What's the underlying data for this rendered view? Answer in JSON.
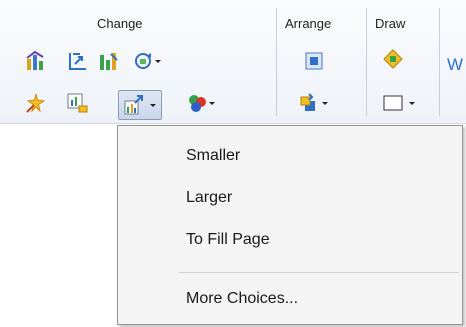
{
  "ribbon": {
    "groups": [
      {
        "label": "Change"
      },
      {
        "label": "Arrange"
      },
      {
        "label": "Draw"
      }
    ],
    "right_edge_fragment": "W",
    "accent_color": "#2a6fd0"
  },
  "icons": {
    "change_row1": [
      "chart-type-icon",
      "axis-titles-icon",
      "data-series-icon",
      "rotate-dropdown-icon"
    ],
    "change_row2": [
      "wizard-icon",
      "chart-data-icon",
      "resize-dropdown-icon",
      "color-scheme-dropdown-icon"
    ],
    "arrange": [
      "bring-forward-icon",
      "position-dropdown-icon"
    ],
    "draw": [
      "shape-fill-icon",
      "rectangle-dropdown-icon"
    ]
  },
  "menu": {
    "items": [
      {
        "label": "Smaller"
      },
      {
        "label": "Larger"
      },
      {
        "label": "To Fill Page"
      },
      {
        "label": "More Choices..."
      }
    ]
  }
}
